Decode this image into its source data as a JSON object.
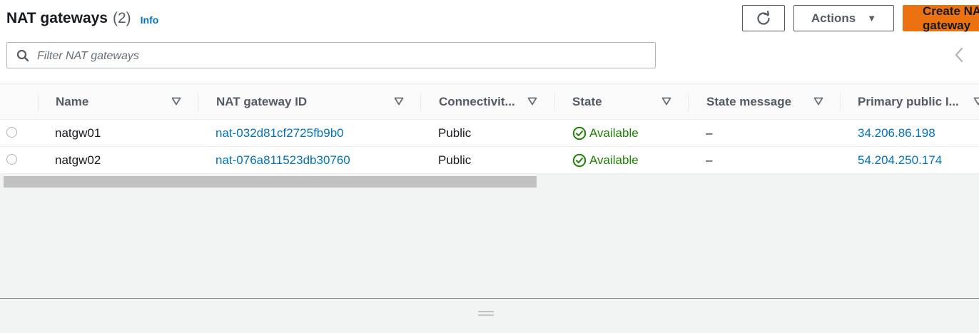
{
  "header": {
    "title": "NAT gateways",
    "count": "(2)",
    "info_label": "Info",
    "actions_label": "Actions",
    "create_label": "Create NAT gateway"
  },
  "search": {
    "placeholder": "Filter NAT gateways"
  },
  "table": {
    "columns": [
      {
        "label": "Name"
      },
      {
        "label": "NAT gateway ID"
      },
      {
        "label": "Connectivit..."
      },
      {
        "label": "State"
      },
      {
        "label": "State message"
      },
      {
        "label": "Primary public I..."
      }
    ],
    "rows": [
      {
        "name": "natgw01",
        "id": "nat-032d81cf2725fb9b0",
        "connectivity": "Public",
        "state": "Available",
        "state_message": "–",
        "public_ip": "34.206.86.198"
      },
      {
        "name": "natgw02",
        "id": "nat-076a811523db30760",
        "connectivity": "Public",
        "state": "Available",
        "state_message": "–",
        "public_ip": "54.204.250.174"
      }
    ]
  },
  "colors": {
    "accent": "#0073bb",
    "primary_button": "#ec7211",
    "status_success": "#1d8102"
  },
  "icons": [
    "refresh-icon",
    "caret-down-icon",
    "search-icon",
    "sort-icon",
    "chevron-left-icon",
    "check-circle-icon",
    "resize-handle-icon"
  ]
}
